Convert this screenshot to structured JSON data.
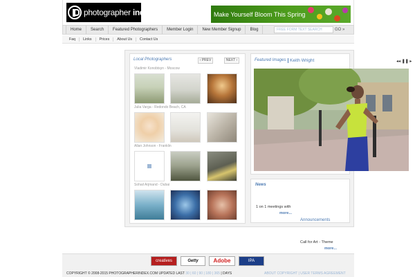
{
  "header": {
    "logo_text_light": "photographer ",
    "logo_text_bold": "index",
    "banner_text": "Make Yourself Bloom This Spring"
  },
  "nav": {
    "items": [
      "Home",
      "Search",
      "Featured Photographers",
      "Member Login",
      "New Member Signup",
      "Blog"
    ],
    "search_placeholder": "FREE FORM TEXT SEARCH",
    "go_label": "GO »"
  },
  "subnav": {
    "items": [
      "Faq",
      "Links",
      "Prices",
      "About Us",
      "Contact Us"
    ]
  },
  "local": {
    "title": "Local Photographers",
    "prev_label": "‹ PREV",
    "next_label": "NEXT ›",
    "photographers": [
      {
        "name": "Vladimir Konobtsyn - Moscow"
      },
      {
        "name": "Julia Varga - Redondo Beach, CA"
      },
      {
        "name": "Allan Johnson - Franklin"
      },
      {
        "name": "Sohail Arjmand - Dubai"
      }
    ]
  },
  "featured": {
    "title": "Featured Images",
    "author": "Keith Wright",
    "arrows": "◂◂ ❚❚ ▸"
  },
  "news": {
    "title": "News",
    "item": "1 on 1 meetings with",
    "more_label": "more...",
    "announcements_label": "Announcements"
  },
  "aside": {
    "call_for_art": "Call for Art - Theme",
    "more_label": "more..."
  },
  "footer": {
    "sponsors": [
      "creatives",
      "Getty",
      "Adobe",
      "IPA"
    ],
    "copyright": "COPYRIGHT © 2008-2015 PHOTOGRAPHERINDEX.COM  UPDATED LAST",
    "updated_periods": "30 | 60 | 90 | 180 | 365",
    "days_label": "| DAYS",
    "links": "ABOUT COPYRIGHT | USER TERMS AGREEMENT"
  },
  "colors": {
    "link_blue": "#4d7bb3",
    "banner_green": "#3f8c17"
  }
}
